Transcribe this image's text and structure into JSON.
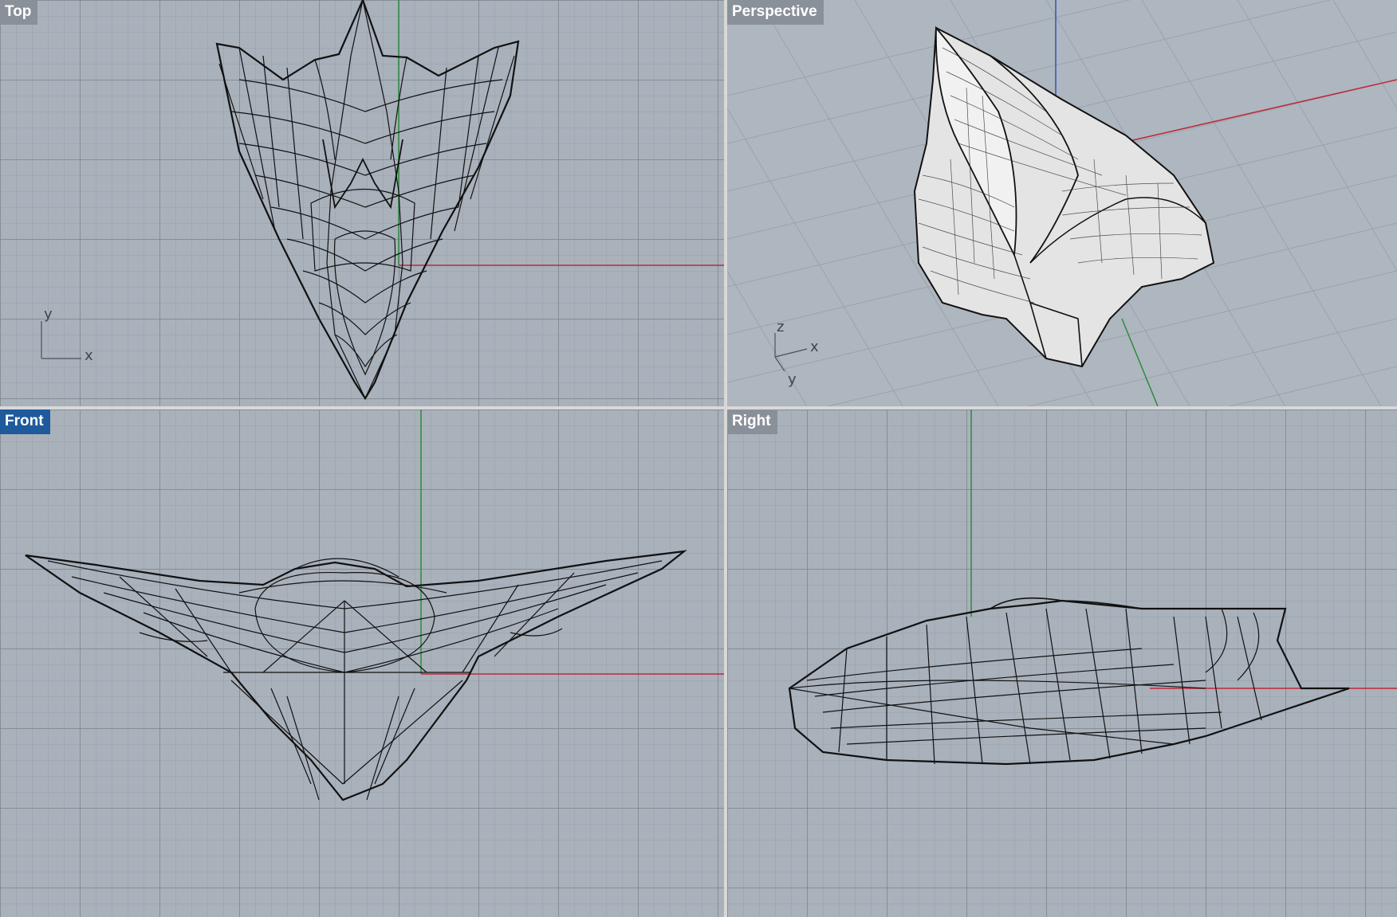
{
  "viewports": {
    "top": {
      "title": "Top",
      "axis_labels": [
        "y",
        "x"
      ]
    },
    "perspective": {
      "title": "Perspective",
      "axis_labels": [
        "z",
        "x",
        "y"
      ]
    },
    "front": {
      "title": "Front",
      "active": true
    },
    "right": {
      "title": "Right"
    }
  },
  "colors": {
    "viewport_bg": "#a9b1bb",
    "active_title_bg": "#1e5a9c",
    "inactive_title_bg": "#8a9099",
    "x_axis": "#c0283a",
    "y_axis": "#2e8b3e",
    "z_axis": "#3a4fc0",
    "wireframe": "#111111"
  }
}
